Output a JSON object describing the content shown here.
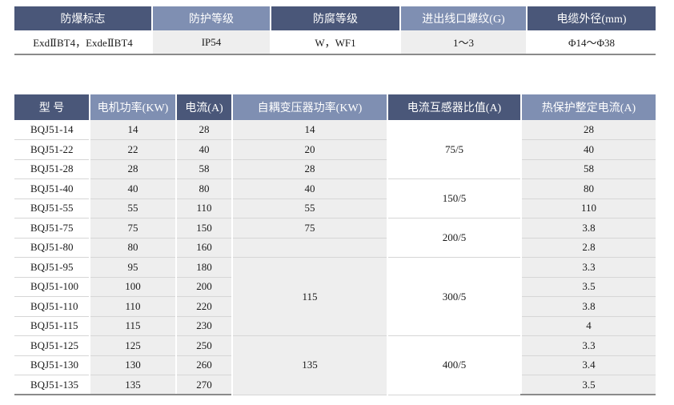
{
  "spec_table": {
    "headers": [
      "防爆标志",
      "防护等级",
      "防腐等级",
      "进出线口螺纹(G)",
      "电缆外径(mm)"
    ],
    "values": [
      "ExdⅡBT4，ExdeⅡBT4",
      "IP54",
      "W，WF1",
      "1～3",
      "Φ14～Φ38"
    ]
  },
  "model_table": {
    "headers": [
      "型 号",
      "电机功率(KW)",
      "电流(A)",
      "自耦变压器功率(KW)",
      "电流互感器比值(A)",
      "热保护整定电流(A)"
    ],
    "models": [
      "BQJ51-14",
      "BQJ51-22",
      "BQJ51-28",
      "BQJ51-40",
      "BQJ51-55",
      "BQJ51-75",
      "BQJ51-80",
      "BQJ51-95",
      "BQJ51-100",
      "BQJ51-110",
      "BQJ51-115",
      "BQJ51-125",
      "BQJ51-130",
      "BQJ51-135"
    ],
    "motor_power": [
      "14",
      "22",
      "28",
      "40",
      "55",
      "75",
      "80",
      "95",
      "100",
      "110",
      "115",
      "125",
      "130",
      "135"
    ],
    "current": [
      "28",
      "40",
      "58",
      "80",
      "110",
      "150",
      "160",
      "180",
      "200",
      "220",
      "230",
      "250",
      "260",
      "270"
    ],
    "transformer_power": [
      "14",
      "20",
      "28",
      "40",
      "55",
      "75",
      "",
      "115",
      "135"
    ],
    "ct_ratio": [
      "75/5",
      "150/5",
      "200/5",
      "300/5",
      "400/5"
    ],
    "thermal_setting": [
      "28",
      "40",
      "58",
      "80",
      "110",
      "3.8",
      "2.8",
      "3.3",
      "3.5",
      "3.8",
      "4",
      "3.3",
      "3.4",
      "3.5"
    ]
  }
}
